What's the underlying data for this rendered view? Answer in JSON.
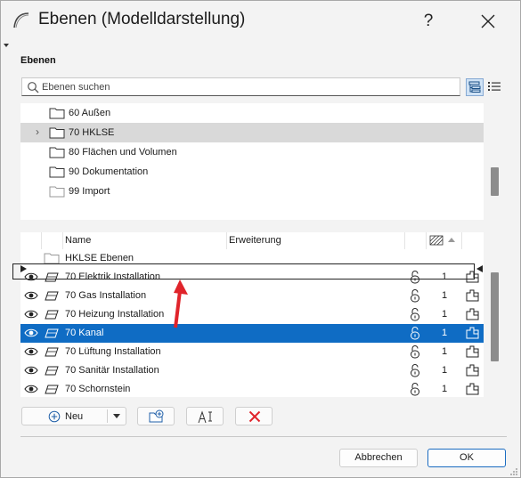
{
  "window": {
    "title": "Ebenen (Modelldarstellung)",
    "help": "?"
  },
  "section": {
    "title": "Ebenen"
  },
  "search": {
    "placeholder": "Ebenen suchen"
  },
  "tree": {
    "items": [
      {
        "label": "60 Außen",
        "selected": false,
        "expandable": false
      },
      {
        "label": "70 HKLSE",
        "selected": true,
        "expandable": true
      },
      {
        "label": "80 Flächen und Volumen",
        "selected": false,
        "expandable": false
      },
      {
        "label": "90 Dokumentation",
        "selected": false,
        "expandable": false
      },
      {
        "label": "99 Import",
        "selected": false,
        "expandable": false
      }
    ]
  },
  "table": {
    "columns": {
      "name": "Name",
      "extension": "Erweiterung"
    },
    "group": "HKLSE Ebenen",
    "rows": [
      {
        "name": "70 Elektrik Installation",
        "count": "1",
        "selected": false
      },
      {
        "name": "70 Gas Installation",
        "count": "1",
        "selected": false
      },
      {
        "name": "70 Heizung Installation",
        "count": "1",
        "selected": false
      },
      {
        "name": "70 Kanal",
        "count": "1",
        "selected": true
      },
      {
        "name": "70 Lüftung Installation",
        "count": "1",
        "selected": false
      },
      {
        "name": "70 Sanitär Installation",
        "count": "1",
        "selected": false
      },
      {
        "name": "70 Schornstein",
        "count": "1",
        "selected": false
      }
    ]
  },
  "toolbar": {
    "new_label": "Neu"
  },
  "buttons": {
    "cancel": "Abbrechen",
    "ok": "OK"
  },
  "colors": {
    "selection": "#0f6cc4",
    "accent_red": "#e0242b"
  }
}
